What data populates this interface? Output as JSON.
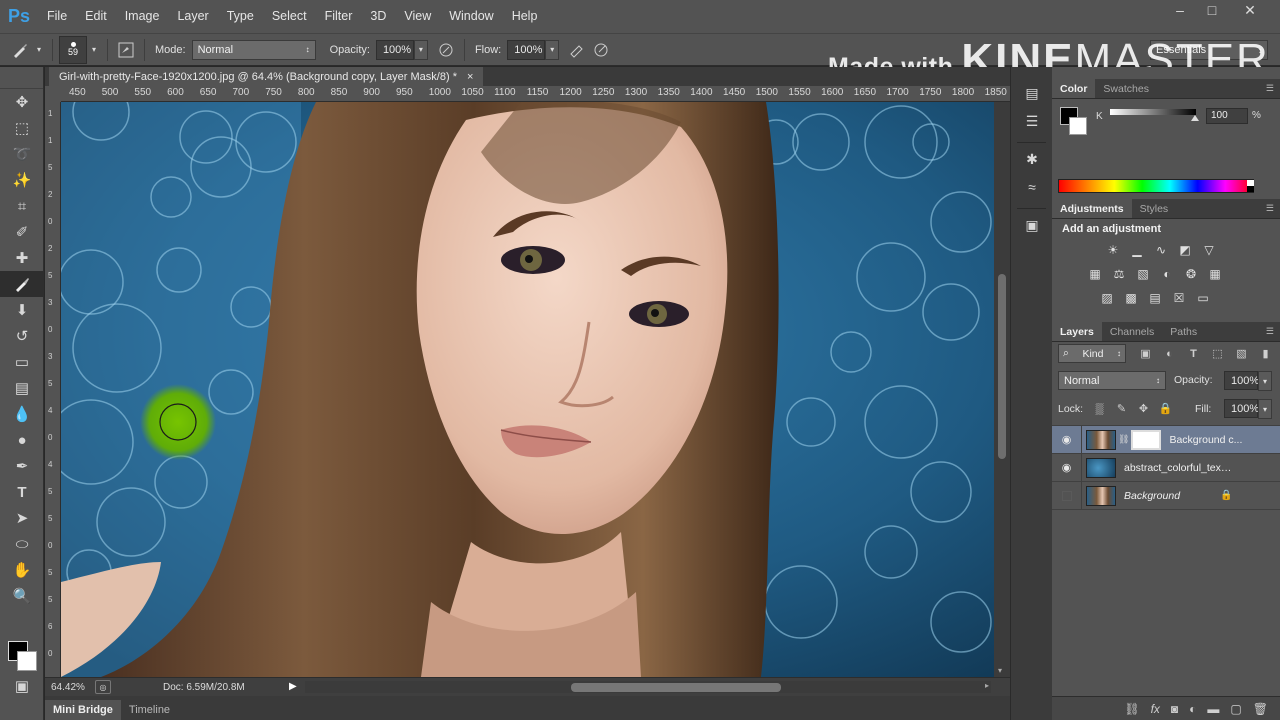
{
  "app": {
    "logo": "Ps"
  },
  "menu": [
    "File",
    "Edit",
    "Image",
    "Layer",
    "Type",
    "Select",
    "Filter",
    "3D",
    "View",
    "Window",
    "Help"
  ],
  "options": {
    "brush_size": "59",
    "mode_label": "Mode:",
    "mode_value": "Normal",
    "opacity_label": "Opacity:",
    "opacity_value": "100%",
    "flow_label": "Flow:",
    "flow_value": "100%",
    "workspace": "Essentials"
  },
  "watermark": {
    "prefix": "Made with",
    "brand_bold": "KINE",
    "brand_thin": "MASTER"
  },
  "document": {
    "tab_title": "Girl-with-pretty-Face-1920x1200.jpg @ 64.4% (Background copy, Layer Mask/8) *",
    "close": "×"
  },
  "ruler_top": [
    "450",
    "500",
    "550",
    "600",
    "650",
    "700",
    "750",
    "800",
    "850",
    "900",
    "950",
    "1000",
    "1050",
    "1100",
    "1150",
    "1200",
    "1250",
    "1300",
    "1350",
    "1400",
    "1450",
    "1500",
    "1550",
    "1600",
    "1650",
    "1700",
    "1750",
    "1800",
    "1850"
  ],
  "ruler_left": [
    "1",
    "1",
    "5",
    "2",
    "0",
    "2",
    "5",
    "3",
    "0",
    "3",
    "5",
    "4",
    "0",
    "4",
    "5",
    "5",
    "0",
    "5",
    "5",
    "6",
    "0"
  ],
  "status": {
    "zoom": "64.42%",
    "doc": "Doc: 6.59M/20.8M"
  },
  "bottom_tabs": [
    "Mini Bridge",
    "Timeline"
  ],
  "color_panel": {
    "tabs": [
      "Color",
      "Swatches"
    ],
    "channel": "K",
    "value": "100",
    "unit": "%"
  },
  "adjustments_panel": {
    "tabs": [
      "Adjustments",
      "Styles"
    ],
    "title": "Add an adjustment"
  },
  "layers_panel": {
    "tabs": [
      "Layers",
      "Channels",
      "Paths"
    ],
    "filter": "Kind",
    "blend_mode": "Normal",
    "opacity_label": "Opacity:",
    "opacity_value": "100%",
    "lock_label": "Lock:",
    "fill_label": "Fill:",
    "fill_value": "100%",
    "layers": [
      {
        "name": "Background c...",
        "visible": true,
        "selected": true
      },
      {
        "name": "abstract_colorful_textur...",
        "visible": true,
        "selected": false
      },
      {
        "name": "Background",
        "visible": false,
        "selected": false,
        "locked": true
      }
    ]
  },
  "colors": {
    "menu_bg": "#535353",
    "panel_bg": "#535353",
    "selected_layer": "#6d7b93",
    "brush_cursor": "#6ab400"
  }
}
